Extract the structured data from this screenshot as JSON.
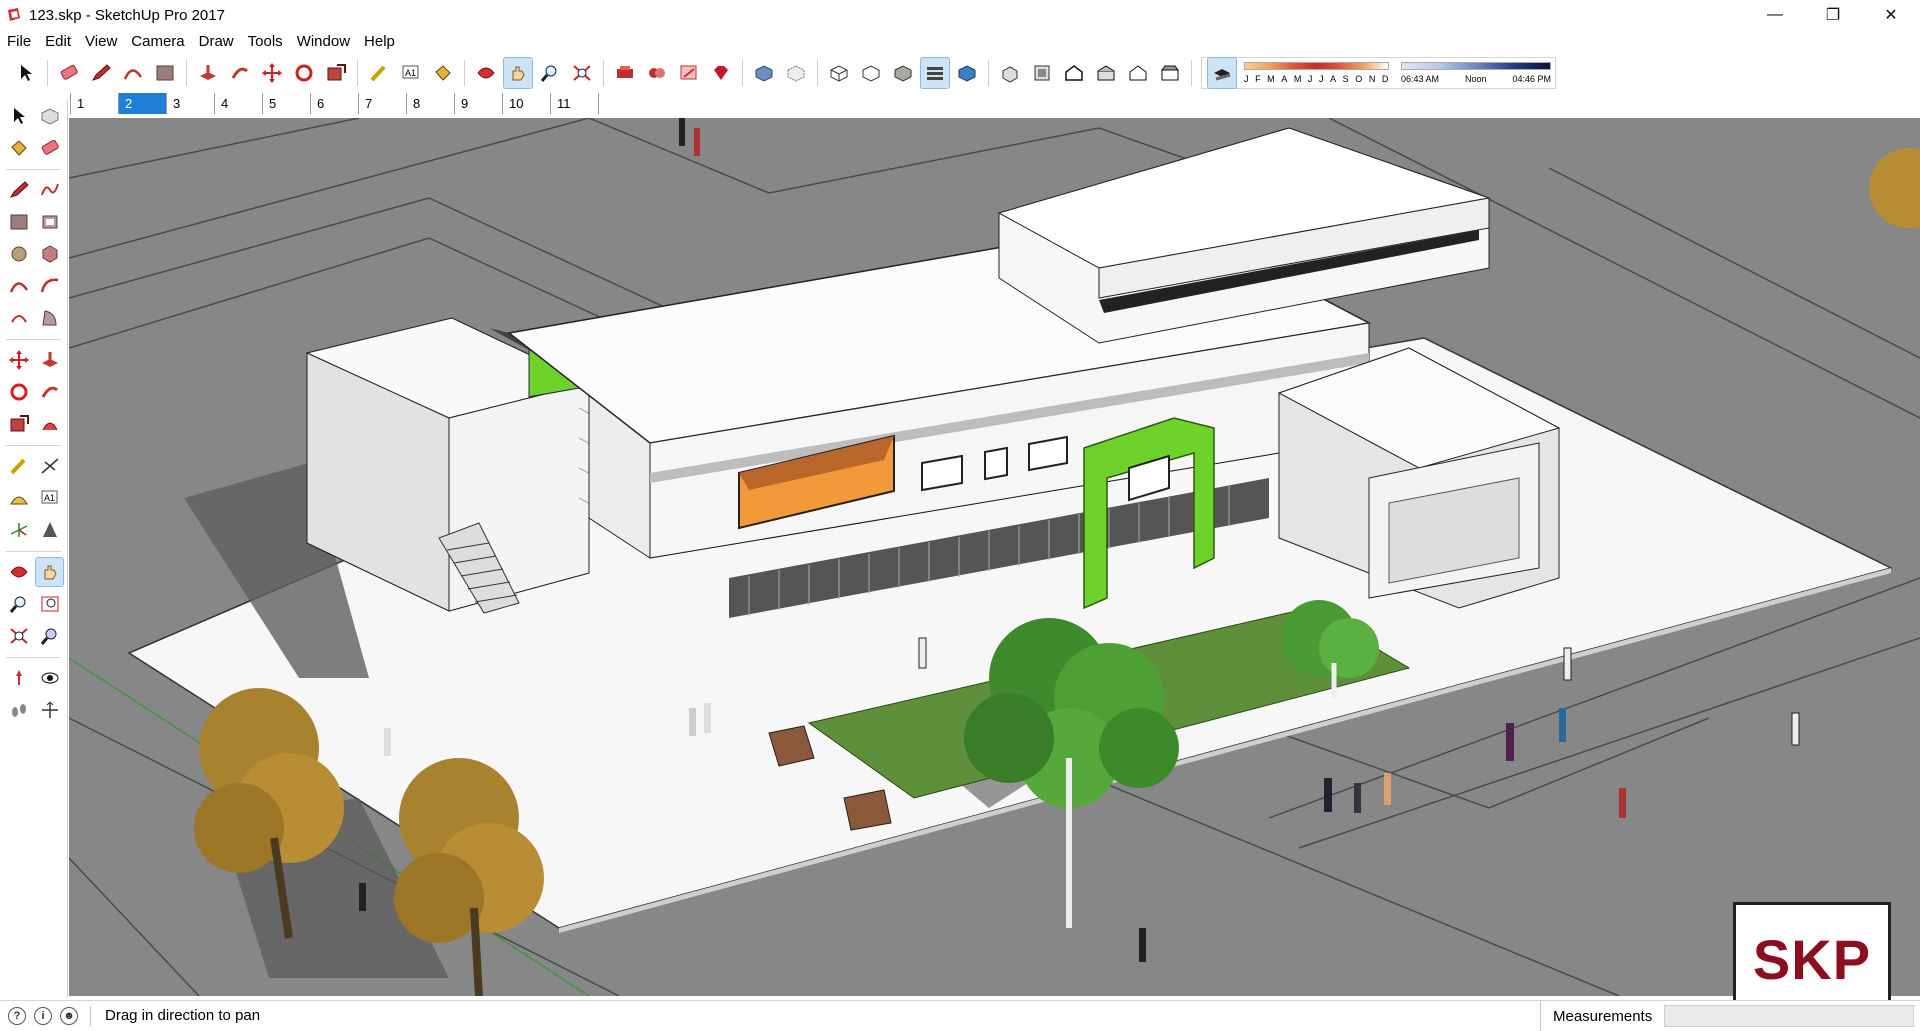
{
  "window": {
    "title": "123.skp - SketchUp Pro 2017",
    "minimize_glyph": "—",
    "maximize_glyph": "❐",
    "close_glyph": "✕"
  },
  "menu": [
    "File",
    "Edit",
    "View",
    "Camera",
    "Draw",
    "Tools",
    "Window",
    "Help"
  ],
  "shadow_settings": {
    "months": [
      "J",
      "F",
      "M",
      "A",
      "M",
      "J",
      "J",
      "A",
      "S",
      "O",
      "N",
      "D"
    ],
    "time_start": "06:43 AM",
    "time_mid": "Noon",
    "time_end": "04:46 PM"
  },
  "scenes": {
    "tabs": [
      "1",
      "2",
      "3",
      "4",
      "5",
      "6",
      "7",
      "8",
      "9",
      "10",
      "11"
    ],
    "active_index": 1
  },
  "toolbar_icons": [
    "select-icon",
    "eraser-icon",
    "pencil-icon",
    "arc-icon",
    "rectangle-icon",
    "push-pull-icon",
    "follow-me-icon",
    "move-icon",
    "rotate-icon",
    "scale-icon",
    "tape-measure-icon",
    "text-icon",
    "paint-bucket-icon",
    "orbit-icon",
    "pan-icon",
    "zoom-icon",
    "zoom-extents-icon",
    "warehouse-icon",
    "extension-warehouse-icon",
    "layout-icon",
    "ruby-icon",
    "xray-icon",
    "back-edges-icon",
    "wireframe-icon",
    "hidden-line-icon",
    "shaded-icon",
    "shaded-textures-icon",
    "monochrome-icon",
    "iso-icon",
    "top-view-icon",
    "front-view-icon",
    "right-view-icon",
    "back-view-icon",
    "left-view-icon",
    "shadows-icon"
  ],
  "status": {
    "hint": "Drag in direction to pan",
    "measurements_label": "Measurements",
    "measurements_value": ""
  },
  "watermark": "SKP",
  "colors": {
    "accent": "#1e7fd8",
    "ground": "#878787",
    "green_frame": "#6fd22a",
    "orange_window": "#f29a3a",
    "logo_red": "#8b0f1e"
  }
}
